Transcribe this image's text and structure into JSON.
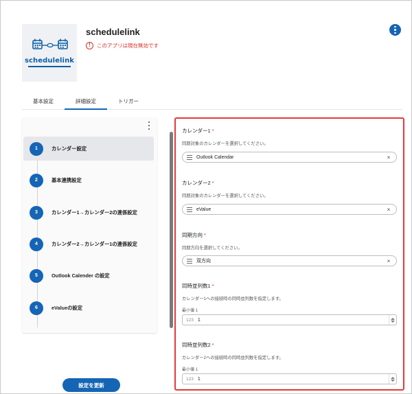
{
  "app": {
    "name": "schedulelink",
    "logo_text": "schedulelink",
    "status_icon": "warning-circle-icon",
    "status_text": "このアプリは現在無効です",
    "more_icon": "vertical-dots-icon"
  },
  "tabs": [
    {
      "label": "基本設定",
      "active": false
    },
    {
      "label": "詳細設定",
      "active": true
    },
    {
      "label": "トリガー",
      "active": false
    }
  ],
  "steps": [
    {
      "number": "1",
      "label": "カレンダー設定",
      "active": true
    },
    {
      "number": "2",
      "label": "基本連携設定",
      "active": false
    },
    {
      "number": "3",
      "label": "カレンダー1→カレンダー2の連係設定",
      "active": false
    },
    {
      "number": "4",
      "label": "カレンダー2→カレンダー1の連係設定",
      "active": false
    },
    {
      "number": "5",
      "label": "Outlook Calender の設定",
      "active": false
    },
    {
      "number": "6",
      "label": "eValueの設定",
      "active": false
    }
  ],
  "update_button": "設定を更新",
  "form": {
    "required_mark": "*",
    "calendar1": {
      "label": "カレンダー1",
      "help": "同期対象のカレンダーを選択してください。",
      "value": "Outlook Calendar",
      "clear": "×"
    },
    "calendar2": {
      "label": "カレンダー2",
      "help": "同期対象のカレンダーを選択してください。",
      "value": "eValue",
      "clear": "×"
    },
    "direction": {
      "label": "同期方向",
      "help": "同期方向を選択してください。",
      "value": "双方向",
      "clear": "×"
    },
    "parallel1": {
      "label": "同時並列数1",
      "help": "カレンダー1への接続時の同時並列数を指定します。",
      "min_label": "最小値",
      "min_value": "1",
      "num_icon": "123",
      "value": "1"
    },
    "parallel2": {
      "label": "同時並列数2",
      "help": "カレンダー2への接続時の同時並列数を指定します。",
      "min_label": "最小値",
      "min_value": "1",
      "num_icon": "123",
      "value": "1"
    }
  },
  "colors": {
    "accent": "#1565b5",
    "error": "#d93025",
    "highlight_border": "#e53935"
  }
}
